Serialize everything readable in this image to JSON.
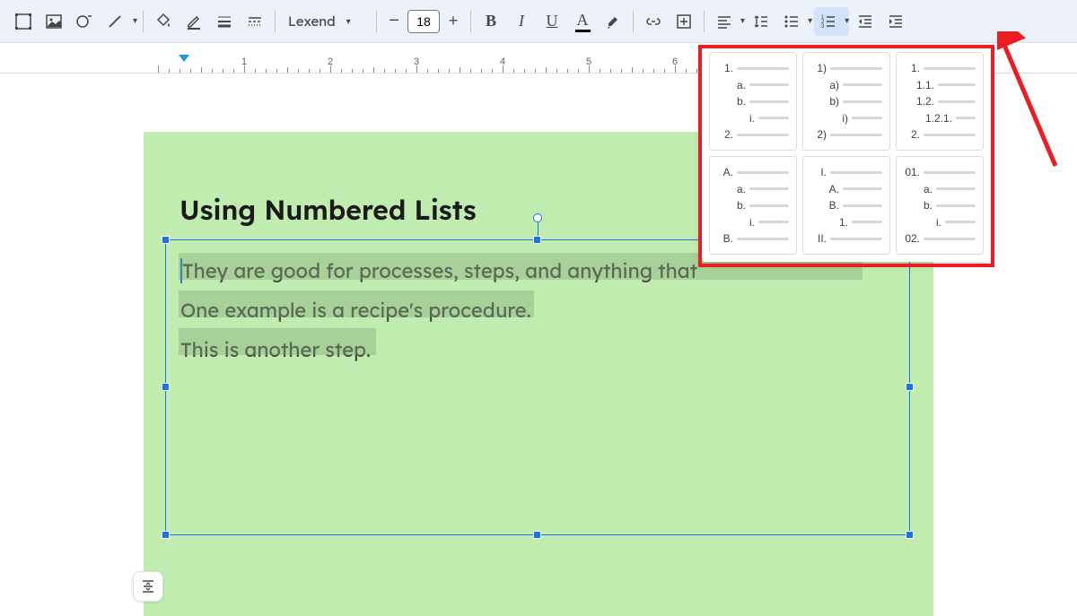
{
  "toolbar": {
    "font_name": "Lexend",
    "font_size": "18",
    "bold": "B",
    "italic": "I",
    "underline": "U",
    "text_format_a": "A"
  },
  "ruler": {
    "marks": [
      1,
      2,
      3,
      4,
      5,
      6
    ]
  },
  "slide": {
    "title": "Using Numbered Lists",
    "lines": [
      "They are good for processes, steps, and anything that",
      "One example is a recipe's procedure.",
      "This is another step."
    ]
  },
  "list_options": [
    {
      "rows": [
        "1.",
        "a.",
        "b.",
        "i.",
        "2."
      ],
      "indents": [
        0,
        1,
        1,
        2,
        0
      ]
    },
    {
      "rows": [
        "1)",
        "a)",
        "b)",
        "i)",
        "2)"
      ],
      "indents": [
        0,
        1,
        1,
        2,
        0
      ]
    },
    {
      "rows": [
        "1.",
        "1.1.",
        "1.2.",
        "1.2.1.",
        "2."
      ],
      "indents": [
        0,
        1,
        1,
        2,
        0
      ]
    },
    {
      "rows": [
        "A.",
        "a.",
        "b.",
        "i.",
        "B."
      ],
      "indents": [
        0,
        1,
        1,
        2,
        0
      ]
    },
    {
      "rows": [
        "I.",
        "A.",
        "B.",
        "1.",
        "II."
      ],
      "indents": [
        0,
        1,
        1,
        2,
        0
      ]
    },
    {
      "rows": [
        "01.",
        "a.",
        "b.",
        "i.",
        "02."
      ],
      "indents": [
        0,
        1,
        1,
        2,
        0
      ]
    }
  ]
}
